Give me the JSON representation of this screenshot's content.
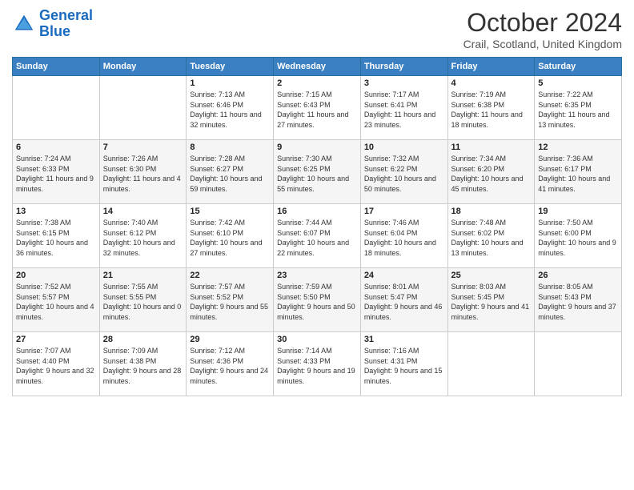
{
  "logo": {
    "line1": "General",
    "line2": "Blue"
  },
  "title": "October 2024",
  "subtitle": "Crail, Scotland, United Kingdom",
  "headers": [
    "Sunday",
    "Monday",
    "Tuesday",
    "Wednesday",
    "Thursday",
    "Friday",
    "Saturday"
  ],
  "weeks": [
    [
      {
        "day": "",
        "sunrise": "",
        "sunset": "",
        "daylight": ""
      },
      {
        "day": "",
        "sunrise": "",
        "sunset": "",
        "daylight": ""
      },
      {
        "day": "1",
        "sunrise": "Sunrise: 7:13 AM",
        "sunset": "Sunset: 6:46 PM",
        "daylight": "Daylight: 11 hours and 32 minutes."
      },
      {
        "day": "2",
        "sunrise": "Sunrise: 7:15 AM",
        "sunset": "Sunset: 6:43 PM",
        "daylight": "Daylight: 11 hours and 27 minutes."
      },
      {
        "day": "3",
        "sunrise": "Sunrise: 7:17 AM",
        "sunset": "Sunset: 6:41 PM",
        "daylight": "Daylight: 11 hours and 23 minutes."
      },
      {
        "day": "4",
        "sunrise": "Sunrise: 7:19 AM",
        "sunset": "Sunset: 6:38 PM",
        "daylight": "Daylight: 11 hours and 18 minutes."
      },
      {
        "day": "5",
        "sunrise": "Sunrise: 7:22 AM",
        "sunset": "Sunset: 6:35 PM",
        "daylight": "Daylight: 11 hours and 13 minutes."
      }
    ],
    [
      {
        "day": "6",
        "sunrise": "Sunrise: 7:24 AM",
        "sunset": "Sunset: 6:33 PM",
        "daylight": "Daylight: 11 hours and 9 minutes."
      },
      {
        "day": "7",
        "sunrise": "Sunrise: 7:26 AM",
        "sunset": "Sunset: 6:30 PM",
        "daylight": "Daylight: 11 hours and 4 minutes."
      },
      {
        "day": "8",
        "sunrise": "Sunrise: 7:28 AM",
        "sunset": "Sunset: 6:27 PM",
        "daylight": "Daylight: 10 hours and 59 minutes."
      },
      {
        "day": "9",
        "sunrise": "Sunrise: 7:30 AM",
        "sunset": "Sunset: 6:25 PM",
        "daylight": "Daylight: 10 hours and 55 minutes."
      },
      {
        "day": "10",
        "sunrise": "Sunrise: 7:32 AM",
        "sunset": "Sunset: 6:22 PM",
        "daylight": "Daylight: 10 hours and 50 minutes."
      },
      {
        "day": "11",
        "sunrise": "Sunrise: 7:34 AM",
        "sunset": "Sunset: 6:20 PM",
        "daylight": "Daylight: 10 hours and 45 minutes."
      },
      {
        "day": "12",
        "sunrise": "Sunrise: 7:36 AM",
        "sunset": "Sunset: 6:17 PM",
        "daylight": "Daylight: 10 hours and 41 minutes."
      }
    ],
    [
      {
        "day": "13",
        "sunrise": "Sunrise: 7:38 AM",
        "sunset": "Sunset: 6:15 PM",
        "daylight": "Daylight: 10 hours and 36 minutes."
      },
      {
        "day": "14",
        "sunrise": "Sunrise: 7:40 AM",
        "sunset": "Sunset: 6:12 PM",
        "daylight": "Daylight: 10 hours and 32 minutes."
      },
      {
        "day": "15",
        "sunrise": "Sunrise: 7:42 AM",
        "sunset": "Sunset: 6:10 PM",
        "daylight": "Daylight: 10 hours and 27 minutes."
      },
      {
        "day": "16",
        "sunrise": "Sunrise: 7:44 AM",
        "sunset": "Sunset: 6:07 PM",
        "daylight": "Daylight: 10 hours and 22 minutes."
      },
      {
        "day": "17",
        "sunrise": "Sunrise: 7:46 AM",
        "sunset": "Sunset: 6:04 PM",
        "daylight": "Daylight: 10 hours and 18 minutes."
      },
      {
        "day": "18",
        "sunrise": "Sunrise: 7:48 AM",
        "sunset": "Sunset: 6:02 PM",
        "daylight": "Daylight: 10 hours and 13 minutes."
      },
      {
        "day": "19",
        "sunrise": "Sunrise: 7:50 AM",
        "sunset": "Sunset: 6:00 PM",
        "daylight": "Daylight: 10 hours and 9 minutes."
      }
    ],
    [
      {
        "day": "20",
        "sunrise": "Sunrise: 7:52 AM",
        "sunset": "Sunset: 5:57 PM",
        "daylight": "Daylight: 10 hours and 4 minutes."
      },
      {
        "day": "21",
        "sunrise": "Sunrise: 7:55 AM",
        "sunset": "Sunset: 5:55 PM",
        "daylight": "Daylight: 10 hours and 0 minutes."
      },
      {
        "day": "22",
        "sunrise": "Sunrise: 7:57 AM",
        "sunset": "Sunset: 5:52 PM",
        "daylight": "Daylight: 9 hours and 55 minutes."
      },
      {
        "day": "23",
        "sunrise": "Sunrise: 7:59 AM",
        "sunset": "Sunset: 5:50 PM",
        "daylight": "Daylight: 9 hours and 50 minutes."
      },
      {
        "day": "24",
        "sunrise": "Sunrise: 8:01 AM",
        "sunset": "Sunset: 5:47 PM",
        "daylight": "Daylight: 9 hours and 46 minutes."
      },
      {
        "day": "25",
        "sunrise": "Sunrise: 8:03 AM",
        "sunset": "Sunset: 5:45 PM",
        "daylight": "Daylight: 9 hours and 41 minutes."
      },
      {
        "day": "26",
        "sunrise": "Sunrise: 8:05 AM",
        "sunset": "Sunset: 5:43 PM",
        "daylight": "Daylight: 9 hours and 37 minutes."
      }
    ],
    [
      {
        "day": "27",
        "sunrise": "Sunrise: 7:07 AM",
        "sunset": "Sunset: 4:40 PM",
        "daylight": "Daylight: 9 hours and 32 minutes."
      },
      {
        "day": "28",
        "sunrise": "Sunrise: 7:09 AM",
        "sunset": "Sunset: 4:38 PM",
        "daylight": "Daylight: 9 hours and 28 minutes."
      },
      {
        "day": "29",
        "sunrise": "Sunrise: 7:12 AM",
        "sunset": "Sunset: 4:36 PM",
        "daylight": "Daylight: 9 hours and 24 minutes."
      },
      {
        "day": "30",
        "sunrise": "Sunrise: 7:14 AM",
        "sunset": "Sunset: 4:33 PM",
        "daylight": "Daylight: 9 hours and 19 minutes."
      },
      {
        "day": "31",
        "sunrise": "Sunrise: 7:16 AM",
        "sunset": "Sunset: 4:31 PM",
        "daylight": "Daylight: 9 hours and 15 minutes."
      },
      {
        "day": "",
        "sunrise": "",
        "sunset": "",
        "daylight": ""
      },
      {
        "day": "",
        "sunrise": "",
        "sunset": "",
        "daylight": ""
      }
    ]
  ]
}
